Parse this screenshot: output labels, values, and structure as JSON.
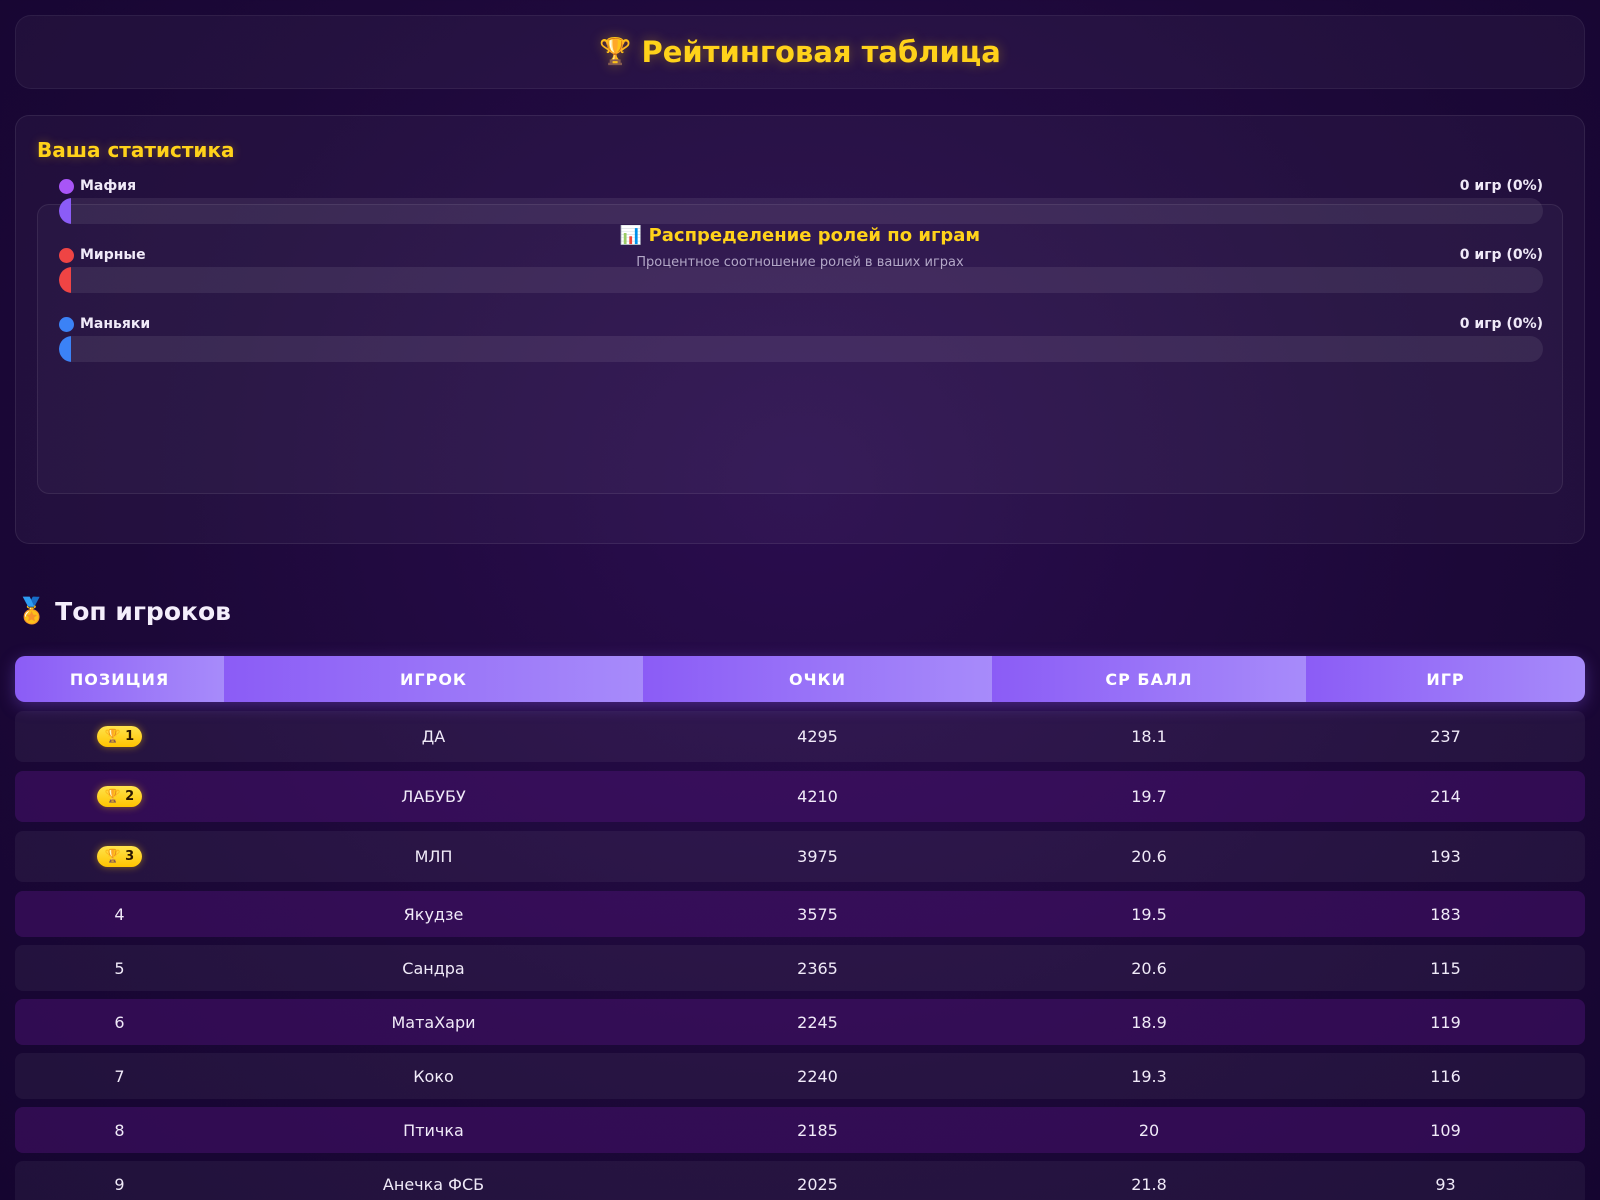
{
  "header": {
    "icon": "trophy-icon",
    "title": "Рейтинговая таблица"
  },
  "stats": {
    "title": "Ваша статистика",
    "roles": {
      "icon": "chart-icon",
      "title": "Распределение ролей по играм",
      "subtitle": "Процентное соотношение ролей в ваших играх",
      "items": [
        {
          "name": "Мафия",
          "count": "0 игр (0%)",
          "percent": 0,
          "color": "#8b5cf6",
          "dot_color": "#a855f7"
        },
        {
          "name": "Мирные",
          "count": "0 игр (0%)",
          "percent": 0,
          "color": "#ef4444",
          "dot_color": "#ef4444"
        },
        {
          "name": "Маньяки",
          "count": "0 игр (0%)",
          "percent": 0,
          "color": "#3b82f6",
          "dot_color": "#3b82f6"
        }
      ]
    }
  },
  "top": {
    "icon": "medal-icon",
    "title": "Топ игроков",
    "columns": [
      "ПОЗИЦИЯ",
      "ИГРОК",
      "ОЧКИ",
      "СР БАЛЛ",
      "ИГР"
    ],
    "rows": [
      {
        "position": "1",
        "player": "ДА",
        "points": "4295",
        "avg": "18.1",
        "games": "237",
        "medal": true
      },
      {
        "position": "2",
        "player": "ЛАБУБУ",
        "points": "4210",
        "avg": "19.7",
        "games": "214",
        "medal": true
      },
      {
        "position": "3",
        "player": "МЛП",
        "points": "3975",
        "avg": "20.6",
        "games": "193",
        "medal": true
      },
      {
        "position": "4",
        "player": "Якудзе",
        "points": "3575",
        "avg": "19.5",
        "games": "183",
        "medal": false
      },
      {
        "position": "5",
        "player": "Сандра",
        "points": "2365",
        "avg": "20.6",
        "games": "115",
        "medal": false
      },
      {
        "position": "6",
        "player": "МатаХари",
        "points": "2245",
        "avg": "18.9",
        "games": "119",
        "medal": false
      },
      {
        "position": "7",
        "player": "Коко",
        "points": "2240",
        "avg": "19.3",
        "games": "116",
        "medal": false
      },
      {
        "position": "8",
        "player": "Птичка",
        "points": "2185",
        "avg": "20",
        "games": "109",
        "medal": false
      },
      {
        "position": "9",
        "player": "Анечка ФСБ",
        "points": "2025",
        "avg": "21.8",
        "games": "93",
        "medal": false
      }
    ]
  },
  "colors": {
    "accent": "#ffd21a",
    "header_purple": "#8b5cf6"
  }
}
